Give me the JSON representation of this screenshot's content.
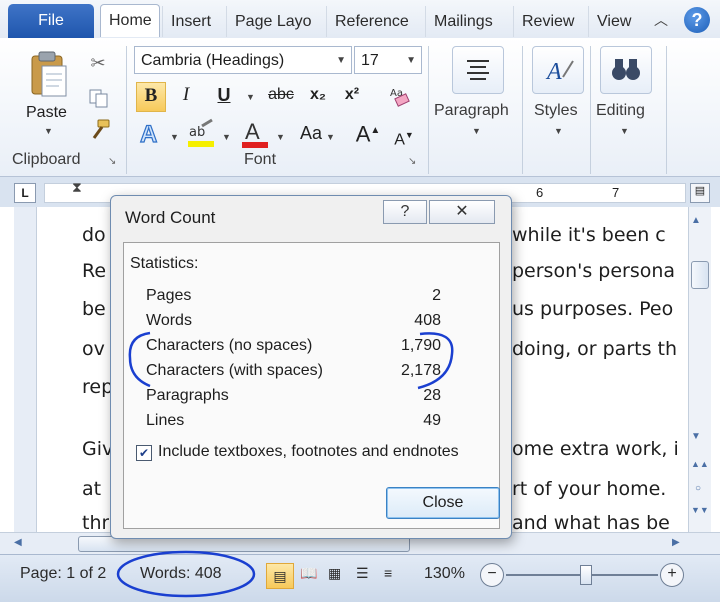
{
  "tabs": {
    "file": "File",
    "items": [
      "Home",
      "Insert",
      "Page Layo",
      "Reference",
      "Mailings",
      "Review",
      "View"
    ]
  },
  "ribbon": {
    "clipboard": {
      "paste": "Paste",
      "group": "Clipboard"
    },
    "font": {
      "group": "Font",
      "font_name": "Cambria (Headings)",
      "font_size": "17",
      "bold": "B",
      "italic": "I",
      "underline": "U",
      "strike": "abc",
      "subscript": "x₂",
      "superscript": "x²",
      "change_case": "Aa",
      "grow": "A",
      "shrink": "A"
    },
    "paragraph": "Paragraph",
    "styles": "Styles",
    "editing": "Editing"
  },
  "ruler": {
    "marks": [
      "6",
      "7"
    ]
  },
  "document": {
    "lines": [
      {
        "left": "do",
        "right": "while it's been c"
      },
      {
        "left": "Re",
        "right": "person's persona"
      },
      {
        "left": "be",
        "right": "us purposes. Peo"
      },
      {
        "left": "ov",
        "right": "doing, or parts th"
      },
      {
        "left": "rep",
        "right": ""
      },
      {
        "left": "Giv",
        "right": "ome extra work, i"
      },
      {
        "left": "at",
        "right": "rt of your home."
      },
      {
        "left": "thr",
        "right": "and what has be"
      }
    ]
  },
  "dialog": {
    "title": "Word Count",
    "help": "?",
    "close_x": "✕",
    "statistics_label": "Statistics:",
    "stats": [
      {
        "label": "Pages",
        "value": "2"
      },
      {
        "label": "Words",
        "value": "408"
      },
      {
        "label": "Characters (no spaces)",
        "value": "1,790"
      },
      {
        "label": "Characters (with spaces)",
        "value": "2,178"
      },
      {
        "label": "Paragraphs",
        "value": "28"
      },
      {
        "label": "Lines",
        "value": "49"
      }
    ],
    "checkbox_label": "Include textboxes, footnotes and endnotes",
    "checkbox_checked": true,
    "close_button": "Close"
  },
  "status": {
    "page": "Page: 1 of 2",
    "words": "Words: 408",
    "zoom": "130%"
  },
  "colors": {
    "file_tab": "#2a62b8",
    "annotation": "#1a3fd0",
    "font_color_bar": "#e02020",
    "highlight_bar": "#f5ef00"
  }
}
